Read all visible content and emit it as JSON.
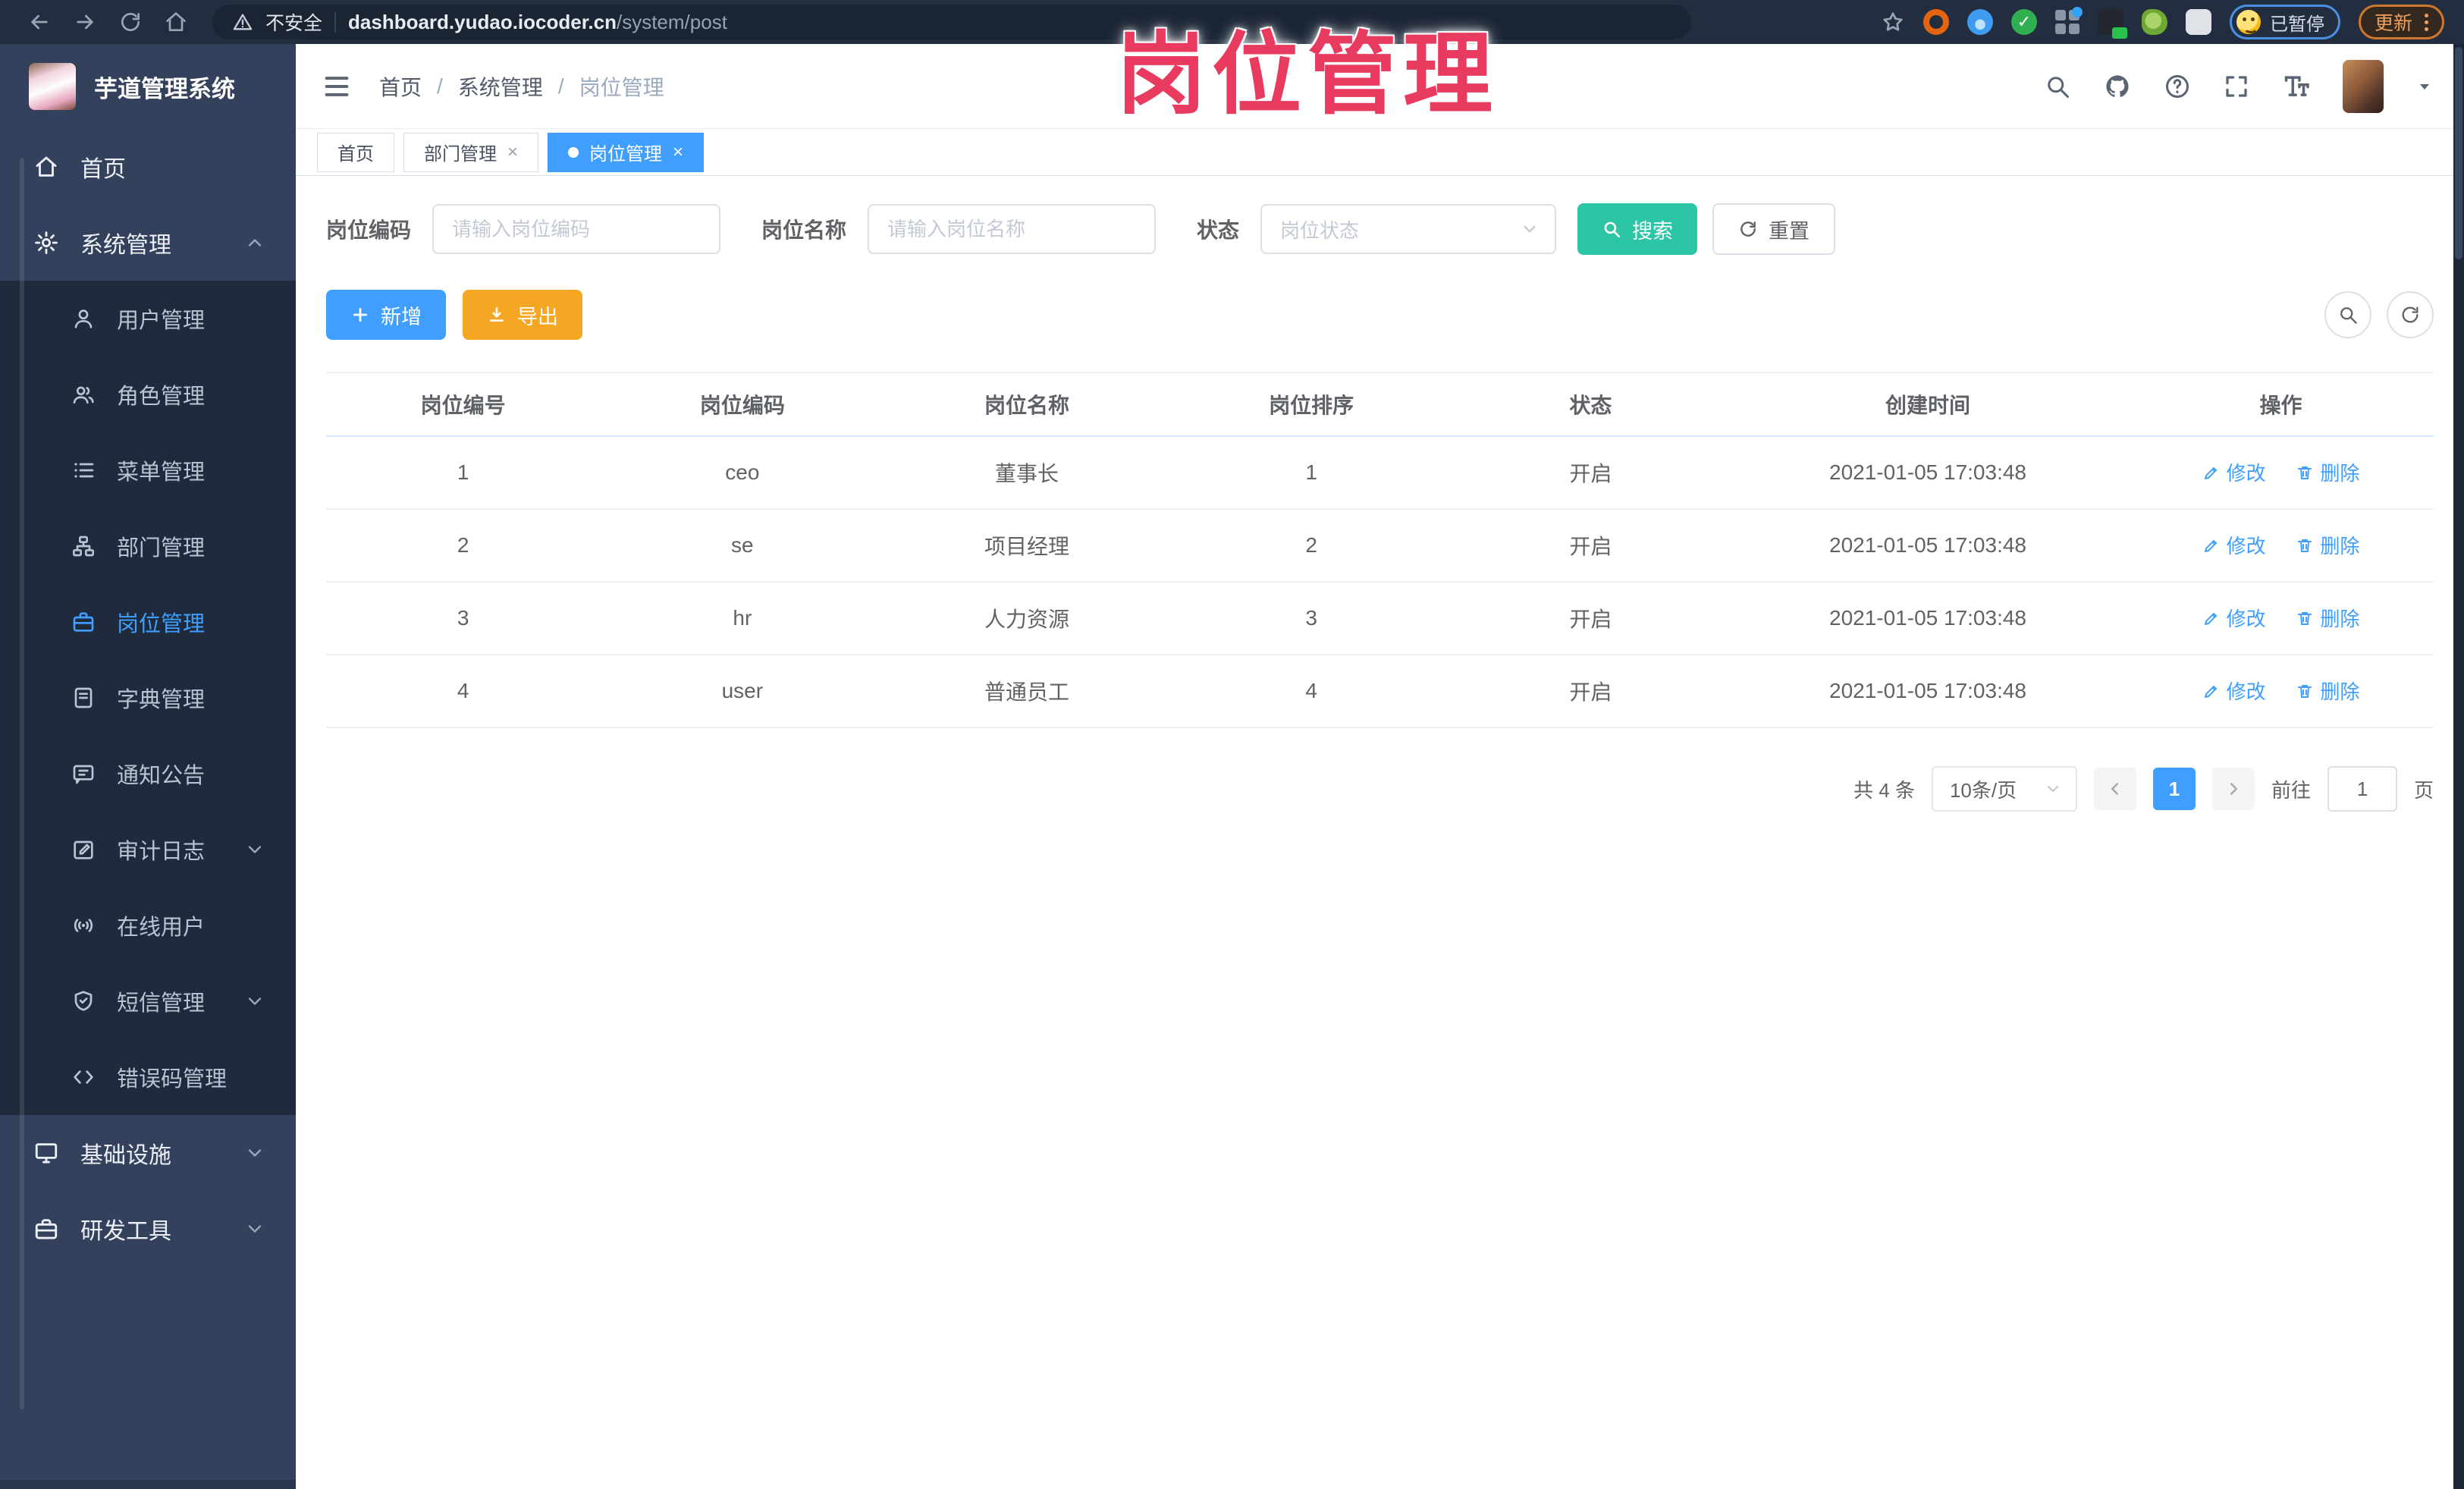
{
  "browser": {
    "security_label": "不安全",
    "url_domain": "dashboard.yudao.iocoder.cn",
    "url_path": "/system/post",
    "profile_status": "已暂停",
    "update_label": "更新"
  },
  "watermark": "岗位管理",
  "sidebar": {
    "logo_title": "芋道管理系统",
    "items": [
      {
        "label": "首页",
        "icon": "home"
      },
      {
        "label": "系统管理",
        "icon": "gear",
        "expanded": true
      },
      {
        "label": "用户管理",
        "icon": "user"
      },
      {
        "label": "角色管理",
        "icon": "users"
      },
      {
        "label": "菜单管理",
        "icon": "menu-list"
      },
      {
        "label": "部门管理",
        "icon": "org-tree"
      },
      {
        "label": "岗位管理",
        "icon": "briefcase",
        "active": true
      },
      {
        "label": "字典管理",
        "icon": "dictionary"
      },
      {
        "label": "通知公告",
        "icon": "announcement"
      },
      {
        "label": "审计日志",
        "icon": "audit-log",
        "collapsed": true
      },
      {
        "label": "在线用户",
        "icon": "online-users"
      },
      {
        "label": "短信管理",
        "icon": "sms-shield",
        "collapsed": true
      },
      {
        "label": "错误码管理",
        "icon": "error-code"
      },
      {
        "label": "基础设施",
        "icon": "infrastructure",
        "collapsed": true
      },
      {
        "label": "研发工具",
        "icon": "dev-tools",
        "collapsed": true
      }
    ]
  },
  "header": {
    "breadcrumb": [
      "首页",
      "系统管理",
      "岗位管理"
    ]
  },
  "tabs": [
    {
      "label": "首页",
      "closable": false,
      "active": false
    },
    {
      "label": "部门管理",
      "closable": true,
      "active": false
    },
    {
      "label": "岗位管理",
      "closable": true,
      "active": true
    }
  ],
  "filters": {
    "code_label": "岗位编码",
    "code_placeholder": "请输入岗位编码",
    "name_label": "岗位名称",
    "name_placeholder": "请输入岗位名称",
    "status_label": "状态",
    "status_placeholder": "岗位状态",
    "search_label": "搜索",
    "reset_label": "重置"
  },
  "toolbar": {
    "add_label": "新增",
    "export_label": "导出"
  },
  "table": {
    "columns": [
      "岗位编号",
      "岗位编码",
      "岗位名称",
      "岗位排序",
      "状态",
      "创建时间",
      "操作"
    ],
    "actions": {
      "edit": "修改",
      "delete": "删除"
    },
    "rows": [
      {
        "id": "1",
        "code": "ceo",
        "name": "董事长",
        "sort": "1",
        "status": "开启",
        "created": "2021-01-05 17:03:48"
      },
      {
        "id": "2",
        "code": "se",
        "name": "项目经理",
        "sort": "2",
        "status": "开启",
        "created": "2021-01-05 17:03:48"
      },
      {
        "id": "3",
        "code": "hr",
        "name": "人力资源",
        "sort": "3",
        "status": "开启",
        "created": "2021-01-05 17:03:48"
      },
      {
        "id": "4",
        "code": "user",
        "name": "普通员工",
        "sort": "4",
        "status": "开启",
        "created": "2021-01-05 17:03:48"
      }
    ]
  },
  "pagination": {
    "total": "共 4 条",
    "page_size": "10条/页",
    "current_page": "1",
    "goto_label": "前往",
    "goto_value": "1",
    "page_unit": "页"
  },
  "colors": {
    "primary": "#409EFF",
    "search_button": "#2CC5A6",
    "export_button": "#F5A623",
    "watermark": "#E93A5F",
    "sidebar_bg": "#33415C",
    "submenu_bg": "#1F2B3D",
    "browser_bar_bg": "#222D3F"
  }
}
